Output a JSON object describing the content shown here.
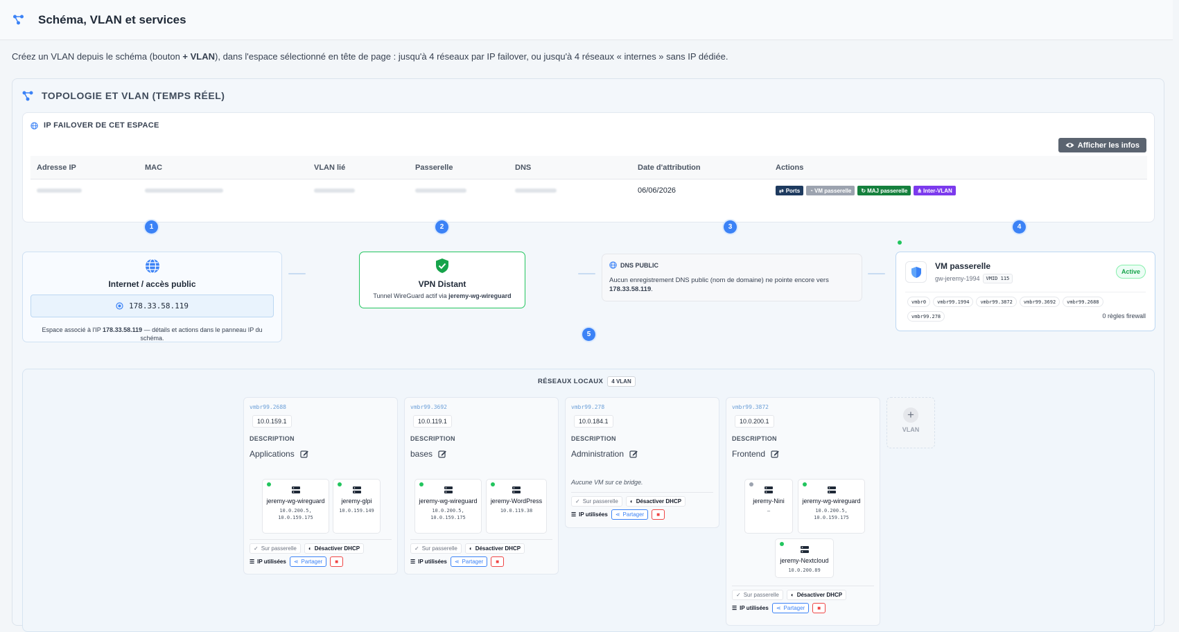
{
  "header": {
    "title": "Schéma, VLAN et services"
  },
  "intro": {
    "pre": "Créez un VLAN depuis le schéma (bouton ",
    "bold": "+ VLAN",
    "post": "), dans l'espace sélectionné en tête de page : jusqu'à 4 réseaux par IP failover, ou jusqu'à 4 réseaux « internes » sans IP dédiée."
  },
  "panel": {
    "title": "TOPOLOGIE ET VLAN (TEMPS RÉEL)"
  },
  "ip_section": {
    "title": "IP FAILOVER DE CET ESPACE",
    "show_button": "Afficher les infos",
    "columns": [
      "Adresse IP",
      "MAC",
      "VLAN lié",
      "Passerelle",
      "DNS",
      "Date d'attribution",
      "Actions"
    ],
    "row": {
      "date": "06/06/2026"
    },
    "actions": [
      {
        "label": "Ports",
        "color": "#1e3a5f"
      },
      {
        "label": "VM passerelle",
        "color": "#9ca3af"
      },
      {
        "label": "MAJ passerelle",
        "color": "#15803d"
      },
      {
        "label": "Inter-VLAN",
        "color": "#7c3aed"
      }
    ]
  },
  "steps": [
    "1",
    "2",
    "3",
    "4",
    "5"
  ],
  "internet": {
    "title": "Internet / accès public",
    "ip": "178.33.58.119",
    "note_pre": "Espace associé à l'IP ",
    "note_ip": "178.33.58.119",
    "note_post": " — détails et actions dans le panneau IP du schéma."
  },
  "vpn": {
    "title": "VPN Distant",
    "desc_pre": "Tunnel WireGuard actif via ",
    "desc_bold": "jeremy-wg-wireguard"
  },
  "dns": {
    "title": "DNS PUBLIC",
    "text": "Aucun enregistrement DNS public (nom de domaine) ne pointe encore vers",
    "ip": "178.33.58.119",
    "ip_suffix": "."
  },
  "gateway": {
    "title": "VM passerelle",
    "host": "gw-jeremy-1994",
    "vmid": "VMID 115",
    "status": "Active",
    "bridges": [
      "vmbr0",
      "vmbr99.1994",
      "vmbr99.3872",
      "vmbr99.3692",
      "vmbr99.2688",
      "vmbr99.278"
    ],
    "firewall": "0 règles firewall"
  },
  "lan": {
    "title": "RÉSEAUX LOCAUX",
    "count": "4 VLAN",
    "add_label": "VLAN",
    "add_icon": "+"
  },
  "vlans": [
    {
      "bridge": "vmbr99.2688",
      "gw": "10.0.159.1",
      "desc_label": "DESCRIPTION",
      "desc": "Applications",
      "vms": [
        {
          "name": "jeremy-wg-wireguard",
          "ip": "10.0.200.5, 10.0.159.175"
        },
        {
          "name": "jeremy-glpi",
          "ip": "10.0.159.149"
        }
      ],
      "controls": {
        "on_gw": "Sur passerelle",
        "dhcp": "Désactiver DHCP",
        "used": "IP utilisées",
        "share": "Partager"
      }
    },
    {
      "bridge": "vmbr99.3692",
      "gw": "10.0.119.1",
      "desc_label": "DESCRIPTION",
      "desc": "bases",
      "vms": [
        {
          "name": "jeremy-wg-wireguard",
          "ip": "10.0.200.5, 10.0.159.175"
        },
        {
          "name": "jeremy-WordPress",
          "ip": "10.0.119.38"
        }
      ],
      "controls": {
        "on_gw": "Sur passerelle",
        "dhcp": "Désactiver DHCP",
        "used": "IP utilisées",
        "share": "Partager"
      }
    },
    {
      "bridge": "vmbr99.278",
      "gw": "10.0.184.1",
      "desc_label": "DESCRIPTION",
      "desc": "Administration",
      "empty": "Aucune VM sur ce bridge.",
      "controls": {
        "on_gw": "Sur passerelle",
        "dhcp": "Désactiver DHCP",
        "used": "IP utilisées",
        "share": "Partager"
      }
    },
    {
      "bridge": "vmbr99.3872",
      "gw": "10.0.200.1",
      "desc_label": "DESCRIPTION",
      "desc": "Frontend",
      "vms": [
        {
          "name": "jeremy-Nini",
          "ip": "–"
        },
        {
          "name": "jeremy-wg-wireguard",
          "ip": "10.0.200.5, 10.0.159.175"
        },
        {
          "name": "jeremy-Nextcloud",
          "ip": "10.0.200.89"
        }
      ],
      "controls": {
        "on_gw": "Sur passerelle",
        "dhcp": "Désactiver DHCP",
        "used": "IP utilisées",
        "share": "Partager"
      }
    }
  ]
}
